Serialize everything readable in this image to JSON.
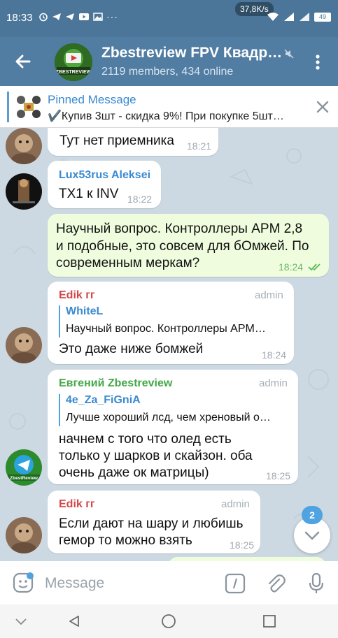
{
  "status_bar": {
    "time": "18:33",
    "net_speed": "37,8K/s",
    "battery": "49"
  },
  "header": {
    "title": "Zbestreview FPV Квадр…",
    "subtitle": "2119 members, 434 online",
    "avatar_text": "ZBESTREVIEW"
  },
  "pinned": {
    "label": "Pinned Message",
    "text": "✔️Купив 3шт - скидка 9%! При покупке 5шт…"
  },
  "messages": [
    {
      "text": "Тут нет приемника",
      "time": "18:21"
    },
    {
      "sender": "Lux53rus Aleksei",
      "text": "TX1 к INV",
      "time": "18:22"
    },
    {
      "lines": [
        "Научный вопрос. Контроллеры APM 2,8",
        "и подобные, это совсем для бОмжей. По",
        "современным меркам?"
      ],
      "time": "18:24",
      "outgoing": true
    },
    {
      "sender": "Edik гг",
      "badge": "admin",
      "reply_name": "WhiteL",
      "reply_text": "Научный вопрос. Контроллеры APM…",
      "text": "Это даже ниже бомжей",
      "time": "18:24"
    },
    {
      "sender": "Евгений Zbestreview",
      "badge": "admin",
      "reply_name": "4e_Za_FiGniA",
      "reply_text": "Лучше хороший лсд, чем хреновый о…",
      "lines": [
        "начнем с того что олед есть",
        "только у шарков и скайзон. оба",
        "очень даже ок матрицы)"
      ],
      "time": "18:25",
      "avatar_text": "ZbestReview"
    },
    {
      "sender": "Edik гг",
      "badge": "admin",
      "lines": [
        "Если дают на шару и любишь",
        "гемор то можно взять"
      ],
      "time": "18:25"
    }
  ],
  "unread_count": "2",
  "composer": {
    "placeholder": "Message"
  },
  "colors": {
    "header": "#517da2",
    "status_bar": "#4c7699",
    "chat_bg": "#ccd9e2",
    "outgoing_bubble": "#effdde",
    "accent": "#3a8ad1",
    "edik_name": "#d2474b",
    "evgeniy_name": "#43a847",
    "lux_name": "#3a8ad1"
  }
}
